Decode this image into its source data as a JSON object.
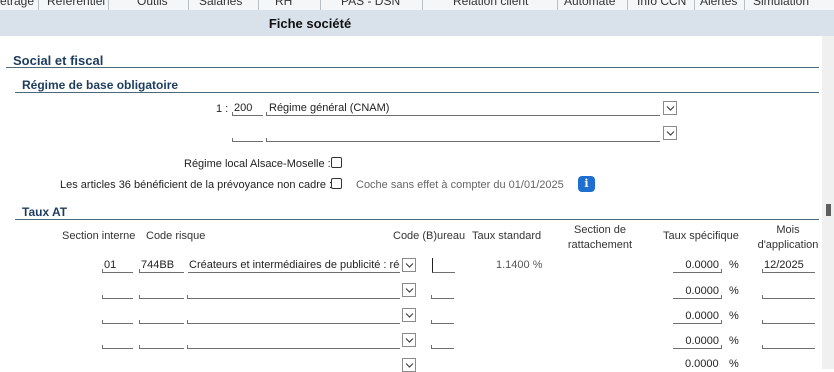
{
  "menu": [
    "etrage",
    "Référentiel",
    "Outils",
    "Salariés",
    "RH",
    "PAS - DSN",
    "Relation client",
    "Automate",
    "Info CCN",
    "Alertes",
    "Simulation"
  ],
  "page_title": "Fiche société",
  "section_title": "Social et fiscal",
  "regime": {
    "title": "Régime de base obligatoire",
    "prefix": "1 :",
    "code": "200",
    "label": "Régime général (CNAM)",
    "second_value": "",
    "alsace_label": "Régime local Alsace-Moselle :",
    "alsace_checked": false,
    "art36_label": "Les articles 36 bénéficient de la prévoyance non cadre :",
    "art36_checked": false,
    "art36_note": "Coche sans effet à compter du 01/01/2025",
    "info_icon": "info-icon"
  },
  "taux_at": {
    "title": "Taux AT",
    "headers": {
      "section_interne": "Section interne",
      "code_risque": "Code risque",
      "code_bureau": "Code (B)ureau",
      "taux_standard": "Taux standard",
      "section_rattachement": "Section de rattachement",
      "taux_specifique": "Taux spécifique",
      "mois_application": "Mois d'application"
    },
    "rows": [
      {
        "section": "01",
        "code": "744BB",
        "libelle": "Créateurs et intermédiaires de publicité : régie",
        "bureau": "",
        "taux_standard": "1.1400 %",
        "taux_specifique": "0.0000",
        "pct": "%",
        "mois": "12/2025"
      },
      {
        "section": "",
        "code": "",
        "libelle": "",
        "bureau": "",
        "taux_standard": "",
        "taux_specifique": "0.0000",
        "pct": "%",
        "mois": ""
      },
      {
        "section": "",
        "code": "",
        "libelle": "",
        "bureau": "",
        "taux_standard": "",
        "taux_specifique": "0.0000",
        "pct": "%",
        "mois": ""
      },
      {
        "section": "",
        "code": "",
        "libelle": "",
        "bureau": "",
        "taux_standard": "",
        "taux_specifique": "0.0000",
        "pct": "%",
        "mois": ""
      },
      {
        "section": "",
        "code": "",
        "libelle": "",
        "bureau": "",
        "taux_standard": "",
        "taux_specifique": "0.0000",
        "pct": "%",
        "mois": ""
      }
    ]
  }
}
